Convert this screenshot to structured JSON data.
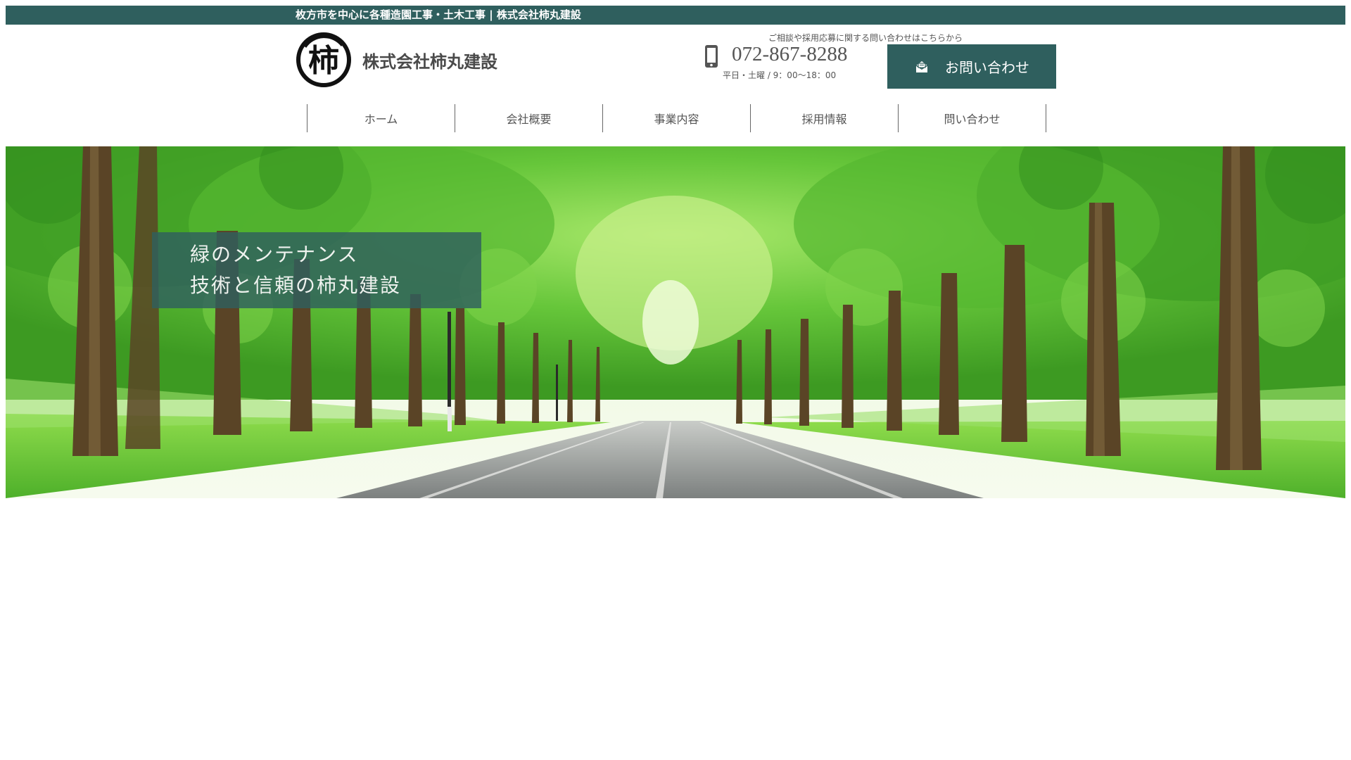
{
  "topbar": {
    "text": "枚方市を中心に各種造園工事・土木工事 | 株式会社柿丸建設"
  },
  "header": {
    "logo_glyph": "柿",
    "company_name": "株式会社柿丸建設",
    "contact_note": "ご相談や採用応募に関する問い合わせはこちらから",
    "phone_number": "072-867-8288",
    "phone_hours": "平日・土曜 / 9：00～18：00",
    "contact_button_label": "お問い合わせ"
  },
  "nav": {
    "items": [
      {
        "label": "ホーム"
      },
      {
        "label": "会社概要"
      },
      {
        "label": "事業内容"
      },
      {
        "label": "採用情報"
      },
      {
        "label": "問い合わせ"
      }
    ]
  },
  "hero": {
    "caption_line1": "緑のメンテナンス",
    "caption_line2": "技術と信頼の柿丸建設"
  },
  "colors": {
    "brand": "#2f5f5e",
    "text": "#444444",
    "foliage": "#5fc13a",
    "road": "#8f9392"
  },
  "icons": {
    "phone": "smartphone-icon",
    "mail": "envelope-icon"
  }
}
